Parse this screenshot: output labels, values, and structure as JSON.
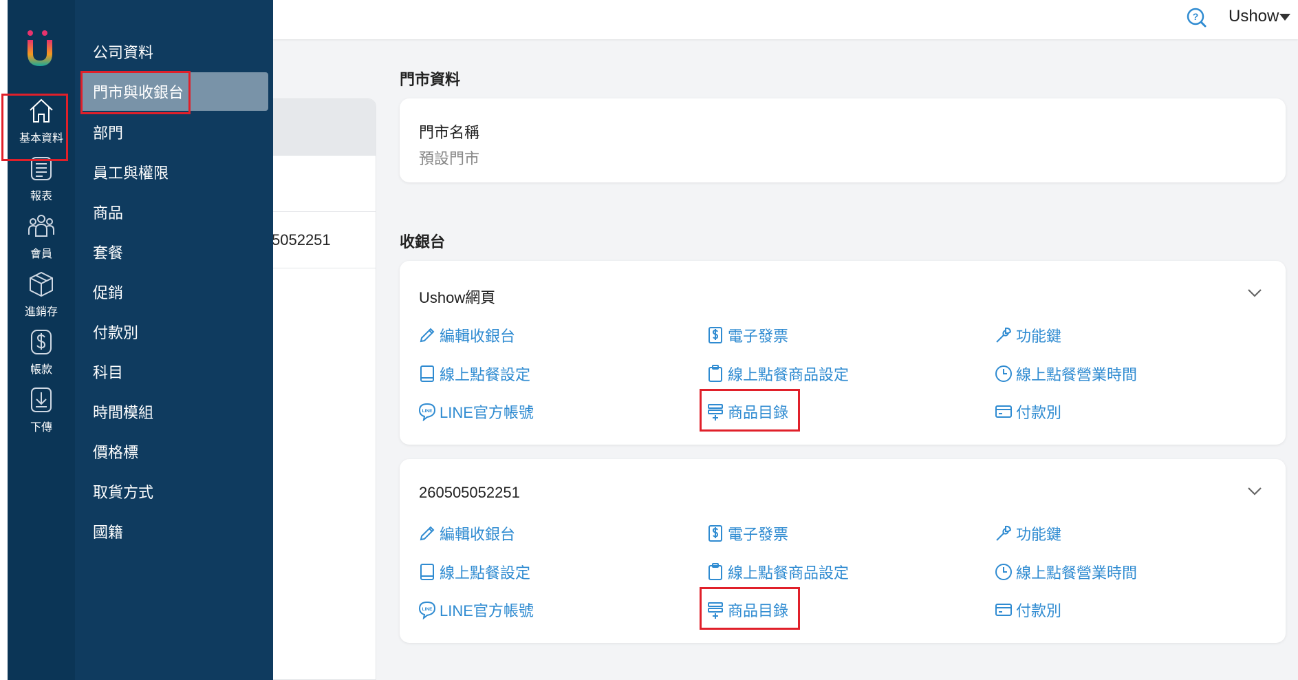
{
  "rail": {
    "items": [
      {
        "label": "基本資料",
        "icon": "home-icon"
      },
      {
        "label": "報表",
        "icon": "report-icon"
      },
      {
        "label": "會員",
        "icon": "members-icon"
      },
      {
        "label": "進銷存",
        "icon": "inventory-box-icon"
      },
      {
        "label": "帳款",
        "icon": "dollar-icon"
      },
      {
        "label": "下傳",
        "icon": "download-icon"
      }
    ]
  },
  "submenu": {
    "items": [
      {
        "label": "公司資料"
      },
      {
        "label": "門市與收銀台"
      },
      {
        "label": "部門"
      },
      {
        "label": "員工與權限"
      },
      {
        "label": "商品"
      },
      {
        "label": "套餐"
      },
      {
        "label": "促銷"
      },
      {
        "label": "付款別"
      },
      {
        "label": "科目"
      },
      {
        "label": "時間模組"
      },
      {
        "label": "價格標"
      },
      {
        "label": "取貨方式"
      },
      {
        "label": "國籍"
      }
    ]
  },
  "topbar": {
    "user": "Ushow"
  },
  "list_panel": {
    "rows": [
      "",
      "5052251"
    ]
  },
  "store": {
    "section_title": "門市資料",
    "name_label": "門市名稱",
    "name_value": "預設門市"
  },
  "registers": {
    "section_title": "收銀台",
    "items": [
      {
        "name": "Ushow網頁",
        "actions": {
          "edit": "編輯收銀台",
          "einvoice": "電子發票",
          "function_keys": "功能鍵",
          "online_order_settings": "線上點餐設定",
          "online_order_products": "線上點餐商品設定",
          "online_order_hours": "線上點餐營業時間",
          "line_account": "LINE官方帳號",
          "product_catalog": "商品目錄",
          "payment_methods": "付款別"
        }
      },
      {
        "name": "260505052251",
        "actions": {
          "edit": "編輯收銀台",
          "einvoice": "電子發票",
          "function_keys": "功能鍵",
          "online_order_settings": "線上點餐設定",
          "online_order_products": "線上點餐商品設定",
          "online_order_hours": "線上點餐營業時間",
          "line_account": "LINE官方帳號",
          "product_catalog": "商品目錄",
          "payment_methods": "付款別"
        }
      }
    ]
  },
  "colors": {
    "rail_bg": "#0b3556",
    "submenu_bg": "#0f3b5f",
    "active_item_bg": "#7993a8",
    "link_blue": "#2f8bd1",
    "highlight_red": "#e0202a"
  }
}
